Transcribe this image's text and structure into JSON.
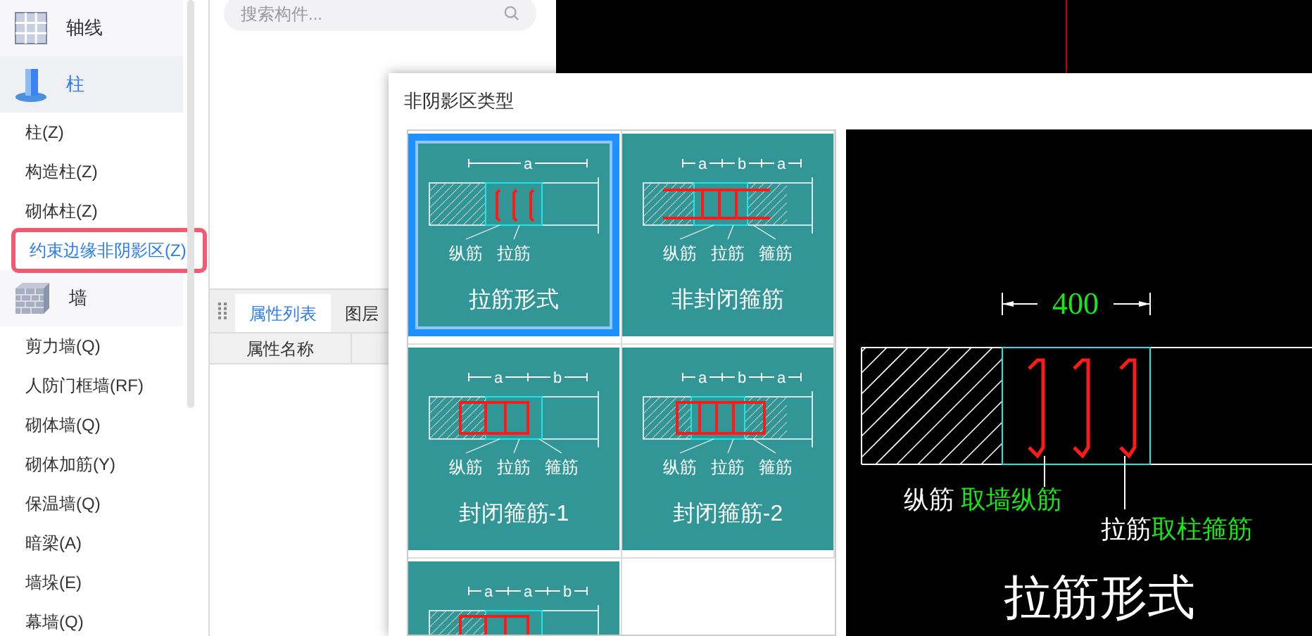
{
  "sidebar": {
    "groups": [
      {
        "kind": "axis",
        "label": "轴线",
        "selected": false
      },
      {
        "kind": "column",
        "label": "柱",
        "selected": true,
        "items": [
          {
            "label": "柱(Z)",
            "selected": false
          },
          {
            "label": "构造柱(Z)",
            "selected": false
          },
          {
            "label": "砌体柱(Z)",
            "selected": false
          },
          {
            "label": "约束边缘非阴影区(Z)",
            "selected": true
          }
        ]
      },
      {
        "kind": "wall",
        "label": "墙",
        "selected": false,
        "items": [
          {
            "label": "剪力墙(Q)",
            "selected": false
          },
          {
            "label": "人防门框墙(RF)",
            "selected": false
          },
          {
            "label": "砌体墙(Q)",
            "selected": false
          },
          {
            "label": "砌体加筋(Y)",
            "selected": false
          },
          {
            "label": "保温墙(Q)",
            "selected": false
          },
          {
            "label": "暗梁(A)",
            "selected": false
          },
          {
            "label": "墙垛(E)",
            "selected": false
          },
          {
            "label": "幕墙(Q)",
            "selected": false
          }
        ]
      }
    ]
  },
  "search": {
    "placeholder": "搜索构件..."
  },
  "property_panel": {
    "tabs": [
      {
        "label": "属性列表",
        "selected": true
      },
      {
        "label": "图层",
        "selected": false
      }
    ],
    "columns": [
      "属性名称"
    ]
  },
  "dialog": {
    "title": "非阴影区类型",
    "options": [
      {
        "kind": "tie",
        "title": "拉筋形式",
        "selected": true,
        "dims": [
          "a"
        ],
        "callouts": [
          "纵筋",
          "拉筋"
        ]
      },
      {
        "kind": "open-stirrup",
        "title": "非封闭箍筋",
        "selected": false,
        "dims": [
          "a",
          "b",
          "a"
        ],
        "callouts": [
          "纵筋",
          "拉筋",
          "箍筋"
        ]
      },
      {
        "kind": "closed-stirrup",
        "title": "封闭箍筋-1",
        "selected": false,
        "dims": [
          "a",
          "b"
        ],
        "callouts": [
          "纵筋",
          "拉筋",
          "箍筋"
        ]
      },
      {
        "kind": "closed-stirrup-2",
        "title": "封闭箍筋-2",
        "selected": false,
        "dims": [
          "a",
          "b",
          "a"
        ],
        "callouts": [
          "纵筋",
          "拉筋",
          "箍筋"
        ]
      },
      {
        "kind": "closed-stirrup",
        "selected": false,
        "dims": [
          "a",
          "a",
          "b"
        ]
      }
    ],
    "preview": {
      "dimension": "400",
      "callouts": [
        {
          "label": "纵筋",
          "value": "取墙纵筋"
        },
        {
          "label": "拉筋",
          "value": "取柱箍筋"
        }
      ],
      "title": "拉筋形式"
    }
  }
}
